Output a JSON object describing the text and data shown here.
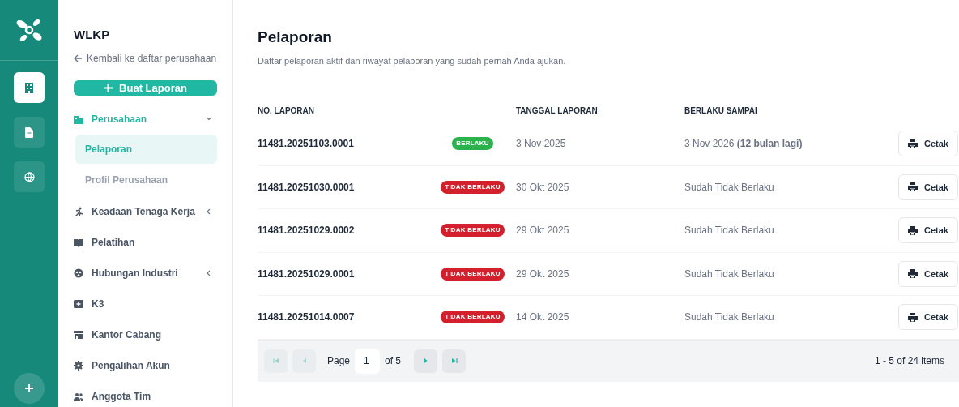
{
  "rail": {
    "items": [
      {
        "selected": true
      },
      {
        "selected": false
      },
      {
        "selected": false
      }
    ]
  },
  "sidebar": {
    "title": "WLKP",
    "back_link": "Kembali ke daftar perusahaan",
    "create_button": "Buat Laporan",
    "items": [
      {
        "label": "Perusahaan",
        "expanded": true,
        "selected": true,
        "children": [
          {
            "label": "Pelaporan",
            "selected": true
          },
          {
            "label": "Profil Perusahaan",
            "selected": false
          }
        ]
      },
      {
        "label": "Keadaan Tenaga Kerja",
        "expanded": false,
        "selected": false
      },
      {
        "label": "Pelatihan",
        "selected": false
      },
      {
        "label": "Hubungan Industri",
        "expanded": false,
        "selected": false
      },
      {
        "label": "K3",
        "selected": false
      },
      {
        "label": "Kantor Cabang",
        "selected": false
      },
      {
        "label": "Pengalihan Akun",
        "selected": false
      },
      {
        "label": "Anggota Tim",
        "selected": false
      }
    ]
  },
  "page": {
    "title": "Pelaporan",
    "subtitle": "Daftar pelaporan aktif dan riwayat pelaporan yang sudah pernah Anda ajukan."
  },
  "table": {
    "columns": [
      "NO. LAPORAN",
      "TANGGAL LAPORAN",
      "BERLAKU SAMPAI"
    ],
    "rows": [
      {
        "number": "11481.20251103.0001",
        "status": {
          "kind": "active",
          "label": "BERLAKU"
        },
        "date": "3 Nov 2025",
        "valid_until": "3 Nov 2026 **(12 bulan lagi)**",
        "action": "Cetak"
      },
      {
        "number": "11481.20251030.0001",
        "status": {
          "kind": "expired",
          "label": "TIDAK BERLAKU"
        },
        "date": "30 Okt 2025",
        "valid_until": "Sudah Tidak Berlaku",
        "action": "Cetak"
      },
      {
        "number": "11481.20251029.0002",
        "status": {
          "kind": "expired",
          "label": "TIDAK BERLAKU"
        },
        "date": "29 Okt 2025",
        "valid_until": "Sudah Tidak Berlaku",
        "action": "Cetak"
      },
      {
        "number": "11481.20251029.0001",
        "status": {
          "kind": "expired",
          "label": "TIDAK BERLAKU"
        },
        "date": "29 Okt 2025",
        "valid_until": "Sudah Tidak Berlaku",
        "action": "Cetak"
      },
      {
        "number": "11481.20251014.0007",
        "status": {
          "kind": "expired",
          "label": "TIDAK BERLAKU"
        },
        "date": "14 Okt 2025",
        "valid_until": "Sudah Tidak Berlaku",
        "action": "Cetak"
      }
    ]
  },
  "pagination": {
    "first_disabled": true,
    "prev_disabled": true,
    "next_disabled": false,
    "last_disabled": false,
    "page_label": "Page",
    "page": "1",
    "of_label": "of 5",
    "summary": "1 - 5 of 24 items"
  }
}
